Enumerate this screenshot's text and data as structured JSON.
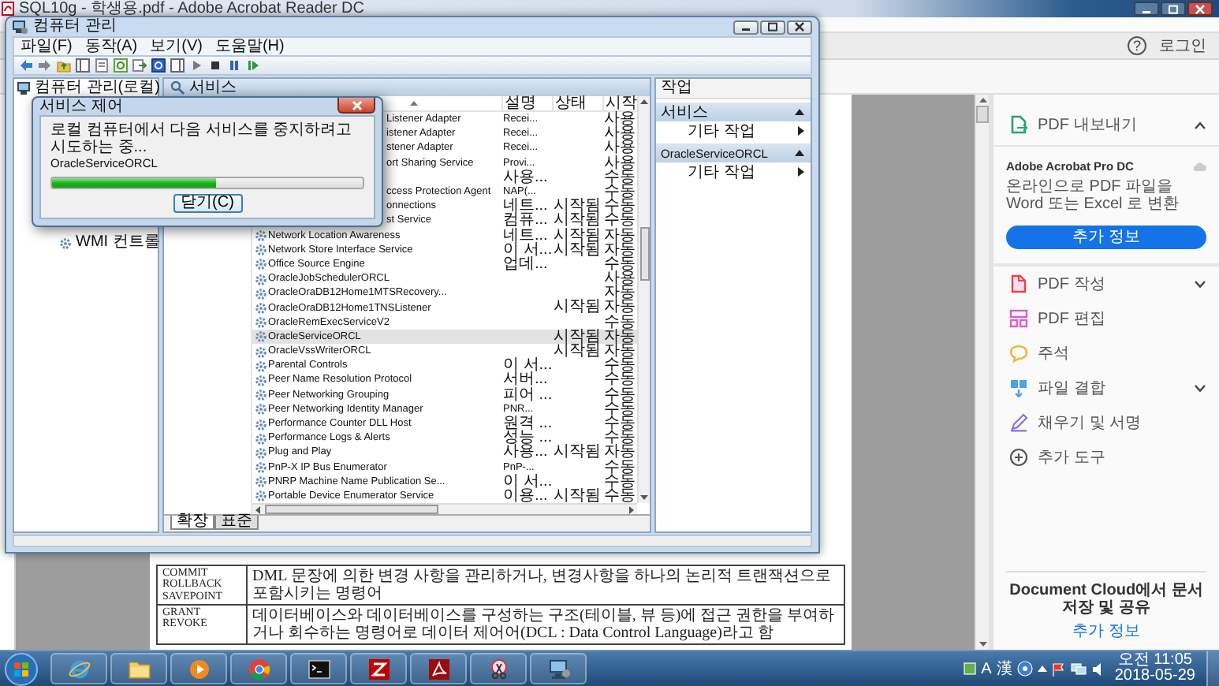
{
  "acrobat": {
    "title": "SQL10g - 학생용.pdf - Adobe Acrobat Reader DC",
    "help": "?",
    "login": "로그인",
    "document_table": [
      {
        "commands": [
          "COMMIT",
          "ROLLBACK",
          "SAVEPOINT"
        ],
        "description": "DML 문장에 의한 변경 사항을 관리하거나, 변경사항을 하나의 논리적 트랜잭션으로 포함시키는 명령어"
      },
      {
        "commands": [
          "GRANT",
          "REVOKE"
        ],
        "description": "데이터베이스와 데이터베이스를 구성하는 구조(테이블, 뷰 등)에 접근 권한을 부여하거나 회수하는 명령어로 데이터 제어어(DCL : Data Control Language)라고 함"
      }
    ],
    "panel": {
      "export": {
        "label": "PDF 내보내기",
        "expanded": true
      },
      "promo": {
        "title": "Adobe Acrobat Pro DC",
        "text": "온라인으로 PDF 파일을 Word 또는 Excel 로 변환",
        "button": "추가 정보"
      },
      "tools": [
        {
          "kind": "create",
          "label": "PDF 작성",
          "expandable": true
        },
        {
          "kind": "edit",
          "label": "PDF 편집",
          "expandable": false
        },
        {
          "kind": "comment",
          "label": "주석",
          "expandable": false
        },
        {
          "kind": "combine",
          "label": "파일 결합",
          "expandable": true
        },
        {
          "kind": "sign",
          "label": "채우기 및 서명",
          "expandable": false
        },
        {
          "kind": "more",
          "label": "추가 도구",
          "expandable": false
        }
      ],
      "cloud_text": "Document Cloud에서 문서 저장 및 공유",
      "cloud_link": "추가 정보"
    }
  },
  "computer_management": {
    "title": "컴퓨터 관리",
    "menu": [
      "파일(F)",
      "동작(A)",
      "보기(V)",
      "도움말(H)"
    ],
    "tree": [
      {
        "label": "컴퓨터 관리(로컬)",
        "children": [
          {
            "label": "WMI 컨트롤"
          }
        ]
      }
    ],
    "services": {
      "title": "서비스",
      "columns": [
        "설명",
        "상태",
        "시작"
      ],
      "rows_under_dialog": [
        {
          "name": "Listener Adapter",
          "description": "Recei...",
          "startup": "사용",
          "selected": false
        },
        {
          "name": "istener Adapter",
          "description": "Recei...",
          "startup": "사용",
          "selected": false
        },
        {
          "name": "stener Adapter",
          "description": "Recei...",
          "startup": "사용",
          "selected": false
        },
        {
          "name": "ort Sharing Service",
          "description": "Provi...",
          "startup": "사용",
          "selected": false
        },
        {
          "description": "사용...",
          "startup": "수동",
          "selected": false
        },
        {
          "name": "ccess Protection Agent",
          "description": "NAP(...",
          "startup": "수동",
          "selected": false
        },
        {
          "name": "onnections",
          "description": "네트...",
          "status": "시작됨",
          "startup": "수동",
          "selected": false
        },
        {
          "name": "st Service",
          "description": "컴퓨...",
          "status": "시작됨",
          "startup": "수동",
          "selected": false
        }
      ],
      "rows": [
        {
          "name": "Network Location Awareness",
          "description": "네트...",
          "status": "시작됨",
          "startup": "자동",
          "selected": false
        },
        {
          "name": "Network Store Interface Service",
          "description": "이 서...",
          "status": "시작됨",
          "startup": "자동",
          "selected": false
        },
        {
          "name": "Office Source Engine",
          "description": "업데...",
          "startup": "수동",
          "selected": false
        },
        {
          "name": "OracleJobSchedulerORCL",
          "startup": "사용",
          "selected": false
        },
        {
          "name": "OracleOraDB12Home1MTSRecovery...",
          "startup": "자동",
          "selected": false
        },
        {
          "name": "OracleOraDB12Home1TNSListener",
          "status": "시작됨",
          "startup": "자동",
          "selected": false
        },
        {
          "name": "OracleRemExecServiceV2",
          "startup": "수동",
          "selected": false
        },
        {
          "name": "OracleServiceORCL",
          "status": "시작됨",
          "startup": "자동",
          "selected": true
        },
        {
          "name": "OracleVssWriterORCL",
          "status": "시작됨",
          "startup": "자동",
          "selected": false
        },
        {
          "name": "Parental Controls",
          "description": "이 서...",
          "startup": "수동",
          "selected": false
        },
        {
          "name": "Peer Name Resolution Protocol",
          "description": "서버...",
          "startup": "수동",
          "selected": false
        },
        {
          "name": "Peer Networking Grouping",
          "description": "피어 ...",
          "startup": "수동",
          "selected": false
        },
        {
          "name": "Peer Networking Identity Manager",
          "description": "PNR...",
          "startup": "수동",
          "selected": false
        },
        {
          "name": "Performance Counter DLL Host",
          "description": "원격 ...",
          "startup": "수동",
          "selected": false
        },
        {
          "name": "Performance Logs & Alerts",
          "description": "성능 ...",
          "startup": "수동",
          "selected": false
        },
        {
          "name": "Plug and Play",
          "description": "사용...",
          "status": "시작됨",
          "startup": "자동",
          "selected": false
        },
        {
          "name": "PnP-X IP Bus Enumerator",
          "description": "PnP-...",
          "startup": "수동",
          "selected": false
        },
        {
          "name": "PNRP Machine Name Publication Se...",
          "description": "이 서...",
          "startup": "수동",
          "selected": false
        },
        {
          "name": "Portable Device Enumerator Service",
          "description": "이용...",
          "status": "시작됨",
          "startup": "수동",
          "selected": false
        }
      ],
      "tabs": [
        {
          "label": "확장",
          "selected": true
        },
        {
          "label": "표준",
          "selected": false
        }
      ]
    },
    "actions": {
      "title": "작업",
      "sections": [
        {
          "label": "서비스",
          "expanded": true,
          "items": [
            "기타 작업"
          ]
        },
        {
          "label": "OracleServiceORCL",
          "expanded": true,
          "items": [
            "기타 작업"
          ]
        }
      ]
    }
  },
  "service_dialog": {
    "title": "서비스 제어",
    "message": "로컬 컴퓨터에서 다음 서비스를 중지하려고 시도하는 중...",
    "service": "OracleServiceORCL",
    "level": 0.53,
    "button": "닫기(C)"
  },
  "taskbar": {
    "apps": [
      {
        "kind": "ie"
      },
      {
        "kind": "explorer"
      },
      {
        "kind": "media"
      },
      {
        "kind": "chrome"
      },
      {
        "kind": "console"
      },
      {
        "kind": "ftp"
      },
      {
        "kind": "pdf"
      },
      {
        "kind": "snipping"
      },
      {
        "kind": "management"
      }
    ],
    "ime_mode": "A",
    "ime_hanja": "漢",
    "time": "오전 11:05",
    "date": "2018-05-29"
  }
}
